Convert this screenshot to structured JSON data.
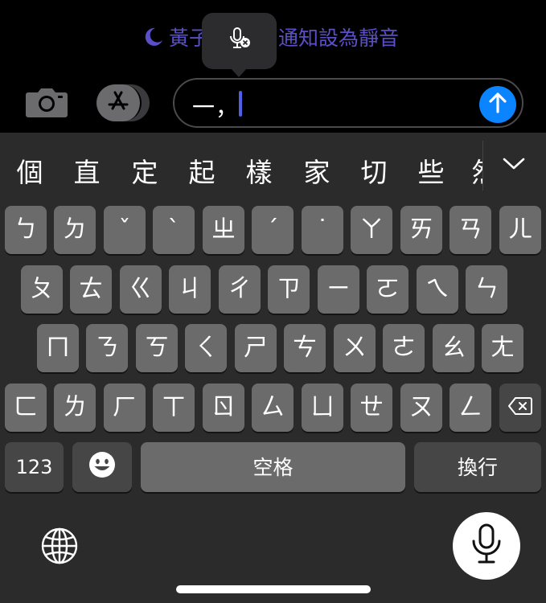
{
  "focus_banner": {
    "text_left": "黃子",
    "text_right": "通知設為靜音",
    "color": "#5a4fc8",
    "icon": "moon-icon"
  },
  "dictation_tooltip": {
    "icon": "mic-off-icon"
  },
  "toolbar": {
    "camera_icon": "camera-icon",
    "apps_icon": "app-store-icon"
  },
  "message": {
    "text": "一，",
    "send_icon": "arrow-up-icon",
    "accent": "#0a84ff"
  },
  "candidates": [
    "個",
    "直",
    "定",
    "起",
    "樣",
    "家",
    "切",
    "些",
    "然"
  ],
  "keyboard": {
    "rows": [
      [
        "ㄅ",
        "ㄉ",
        "ˇ",
        "ˋ",
        "ㄓ",
        "ˊ",
        "˙",
        "ㄚ",
        "ㄞ",
        "ㄢ",
        "ㄦ"
      ],
      [
        "ㄆ",
        "ㄊ",
        "ㄍ",
        "ㄐ",
        "ㄔ",
        "ㄗ",
        "ㄧ",
        "ㄛ",
        "ㄟ",
        "ㄣ"
      ],
      [
        "ㄇ",
        "ㄋ",
        "ㄎ",
        "ㄑ",
        "ㄕ",
        "ㄘ",
        "ㄨ",
        "ㄜ",
        "ㄠ",
        "ㄤ"
      ],
      [
        "ㄈ",
        "ㄌ",
        "ㄏ",
        "ㄒ",
        "ㄖ",
        "ㄙ",
        "ㄩ",
        "ㄝ",
        "ㄡ",
        "ㄥ"
      ]
    ],
    "numbers_label": "123",
    "space_label": "空格",
    "return_label": "換行",
    "delete_icon": "delete-icon",
    "emoji_icon": "emoji-icon",
    "globe_icon": "globe-icon",
    "dictation_icon": "microphone-icon"
  }
}
